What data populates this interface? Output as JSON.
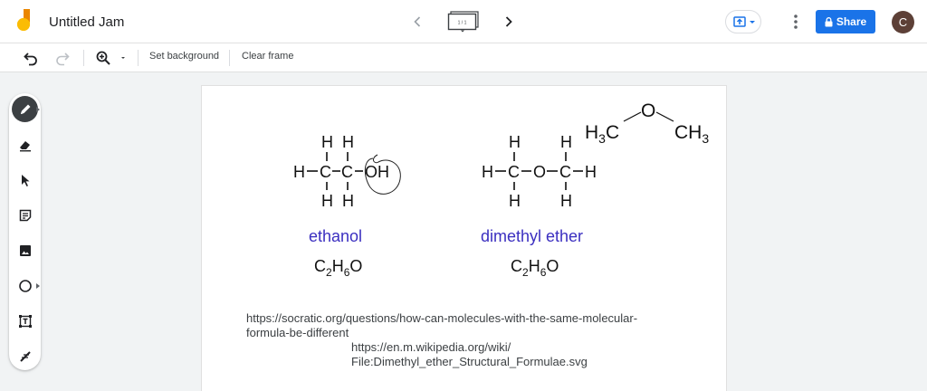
{
  "header": {
    "title": "Untitled Jam",
    "frame_counter": "1 / 1",
    "share_label": "Share",
    "avatar_initial": "C"
  },
  "toolbar": {
    "set_background": "Set background",
    "clear_frame": "Clear frame"
  },
  "sidebar": {
    "tools": [
      "pen",
      "eraser",
      "select",
      "sticky-note",
      "image",
      "circle",
      "text-box",
      "laser"
    ],
    "active_tool": "pen"
  },
  "canvas": {
    "ethanol": {
      "top_h": [
        "H",
        "H"
      ],
      "mid": [
        "H",
        "C",
        "C",
        "OH"
      ],
      "bot_h": [
        "H",
        "H"
      ],
      "name": "ethanol",
      "formula": {
        "c": "C",
        "c_sub": "2",
        "h": "H",
        "h_sub": "6",
        "o": "O"
      }
    },
    "dimethyl_ether": {
      "top_h": [
        "H",
        "H"
      ],
      "mid": [
        "H",
        "C",
        "O",
        "C",
        "H"
      ],
      "bot_h": [
        "H",
        "H"
      ],
      "name": "dimethyl ether",
      "formula": {
        "c": "C",
        "c_sub": "2",
        "h": "H",
        "h_sub": "6",
        "o": "O"
      }
    },
    "skeletal": {
      "left": "H",
      "left_sub": "3",
      "left_c": "C",
      "o": "O",
      "right_c": "CH",
      "right_sub": "3"
    },
    "source_1_line1": "https://socratic.org/questions/how-can-molecules-with-the-same-molecular-",
    "source_1_line2": "formula-be-different",
    "source_2_line1": "https://en.m.wikipedia.org/wiki/",
    "source_2_line2": "File:Dimethyl_ether_Structural_Formulae.svg"
  },
  "colors": {
    "accent": "#1a73e8",
    "name_label": "#3b2fc0",
    "logo_yellow": "#fbbc04",
    "logo_orange": "#ea8600",
    "avatar": "#5d4037"
  }
}
